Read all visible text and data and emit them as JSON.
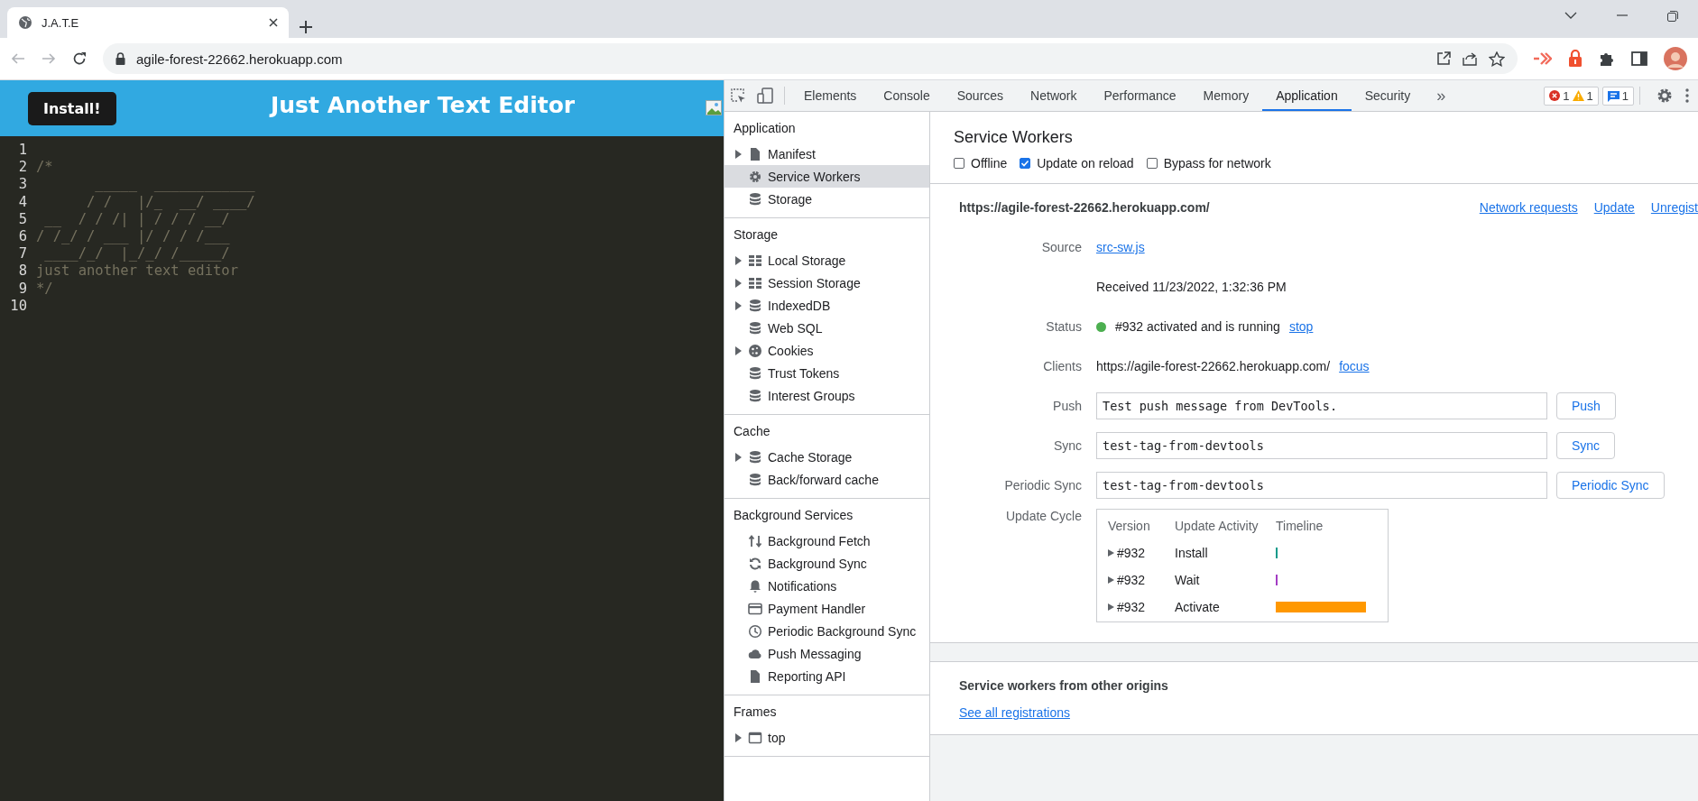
{
  "browser": {
    "tab_title": "J.A.T.E",
    "url": "agile-forest-22662.herokuapp.com"
  },
  "app": {
    "install_button": "Install!",
    "title": "Just Another Text Editor"
  },
  "editor": {
    "lines": [
      {
        "number": "1"
      },
      {
        "number": "2",
        "text": "/*"
      },
      {
        "number": "3",
        "text": "       _____  ____________"
      },
      {
        "number": "4",
        "text": "      / /   |/_  __/ ____/"
      },
      {
        "number": "5",
        "text": " __  / / /| | / / / __/"
      },
      {
        "number": "6",
        "text": "/ /_/ / ___ |/ / / /___"
      },
      {
        "number": "7",
        "text": " ____/_/  |_/_/ /_____/"
      },
      {
        "number": "8",
        "text": "just another text editor"
      },
      {
        "number": "9",
        "text": "*/"
      },
      {
        "number": "10"
      }
    ]
  },
  "devtools": {
    "tabs": [
      {
        "label": "Elements",
        "selected": false
      },
      {
        "label": "Console",
        "selected": false
      },
      {
        "label": "Sources",
        "selected": false
      },
      {
        "label": "Network",
        "selected": false
      },
      {
        "label": "Performance",
        "selected": false
      },
      {
        "label": "Memory",
        "selected": false
      },
      {
        "label": "Application",
        "selected": true
      },
      {
        "label": "Security",
        "selected": false
      }
    ],
    "more": "»",
    "issues": {
      "errors": "1",
      "warnings": "1",
      "messages": "1"
    }
  },
  "sidebar": {
    "sections": [
      {
        "title": "Application",
        "items": [
          {
            "label": "Manifest",
            "kind": "file",
            "expandable": true,
            "selected": false
          },
          {
            "label": "Service Workers",
            "kind": "gear",
            "expandable": false,
            "selected": true
          },
          {
            "label": "Storage",
            "kind": "database",
            "expandable": false,
            "selected": false
          }
        ]
      },
      {
        "title": "Storage",
        "items": [
          {
            "label": "Local Storage",
            "kind": "grid",
            "expandable": true,
            "selected": false
          },
          {
            "label": "Session Storage",
            "kind": "grid",
            "expandable": true,
            "selected": false
          },
          {
            "label": "IndexedDB",
            "kind": "database",
            "expandable": true,
            "selected": false
          },
          {
            "label": "Web SQL",
            "kind": "database",
            "expandable": false,
            "selected": false
          },
          {
            "label": "Cookies",
            "kind": "cookie",
            "expandable": true,
            "selected": false
          },
          {
            "label": "Trust Tokens",
            "kind": "database",
            "expandable": false,
            "selected": false
          },
          {
            "label": "Interest Groups",
            "kind": "database",
            "expandable": false,
            "selected": false
          }
        ]
      },
      {
        "title": "Cache",
        "items": [
          {
            "label": "Cache Storage",
            "kind": "database",
            "expandable": true,
            "selected": false
          },
          {
            "label": "Back/forward cache",
            "kind": "database",
            "expandable": false,
            "selected": false
          }
        ]
      },
      {
        "title": "Background Services",
        "items": [
          {
            "label": "Background Fetch",
            "kind": "arrows",
            "expandable": false,
            "selected": false
          },
          {
            "label": "Background Sync",
            "kind": "sync",
            "expandable": false,
            "selected": false
          },
          {
            "label": "Notifications",
            "kind": "bell",
            "expandable": false,
            "selected": false
          },
          {
            "label": "Payment Handler",
            "kind": "card",
            "expandable": false,
            "selected": false
          },
          {
            "label": "Periodic Background Sync",
            "kind": "clock",
            "expandable": false,
            "selected": false
          },
          {
            "label": "Push Messaging",
            "kind": "cloud",
            "expandable": false,
            "selected": false
          },
          {
            "label": "Reporting API",
            "kind": "file",
            "expandable": false,
            "selected": false
          }
        ]
      },
      {
        "title": "Frames",
        "items": [
          {
            "label": "top",
            "kind": "frame",
            "expandable": true,
            "selected": false
          }
        ]
      }
    ]
  },
  "service_workers": {
    "title": "Service Workers",
    "options": [
      {
        "label": "Offline",
        "checked": false
      },
      {
        "label": "Update on reload",
        "checked": true
      },
      {
        "label": "Bypass for network",
        "checked": false
      }
    ],
    "origin": "https://agile-forest-22662.herokuapp.com/",
    "actions": [
      "Network requests",
      "Update",
      "Unregist"
    ],
    "source_label": "Source",
    "source": "src-sw.js",
    "received": "Received 11/23/2022, 1:32:36 PM",
    "status_label": "Status",
    "status": "#932 activated and is running",
    "stop": "stop",
    "clients_label": "Clients",
    "client": "https://agile-forest-22662.herokuapp.com/",
    "focus": "focus",
    "inputs": [
      {
        "label": "Push",
        "value": "Test push message from DevTools.",
        "button": "Push"
      },
      {
        "label": "Sync",
        "value": "test-tag-from-devtools",
        "button": "Sync"
      },
      {
        "label": "Periodic Sync",
        "value": "test-tag-from-devtools",
        "button": "Periodic Sync"
      }
    ],
    "update_cycle": {
      "label": "Update Cycle",
      "columns": [
        "Version",
        "Update Activity",
        "Timeline"
      ],
      "rows": [
        {
          "version": "#932",
          "activity": "Install",
          "color": "#0e9a8a",
          "kind": "mark"
        },
        {
          "version": "#932",
          "activity": "Wait",
          "color": "#a33cc4",
          "kind": "mark"
        },
        {
          "version": "#932",
          "activity": "Activate",
          "color": "#ff9800",
          "kind": "bar"
        }
      ]
    }
  },
  "other_origins": {
    "title": "Service workers from other origins",
    "link": "See all registrations"
  }
}
